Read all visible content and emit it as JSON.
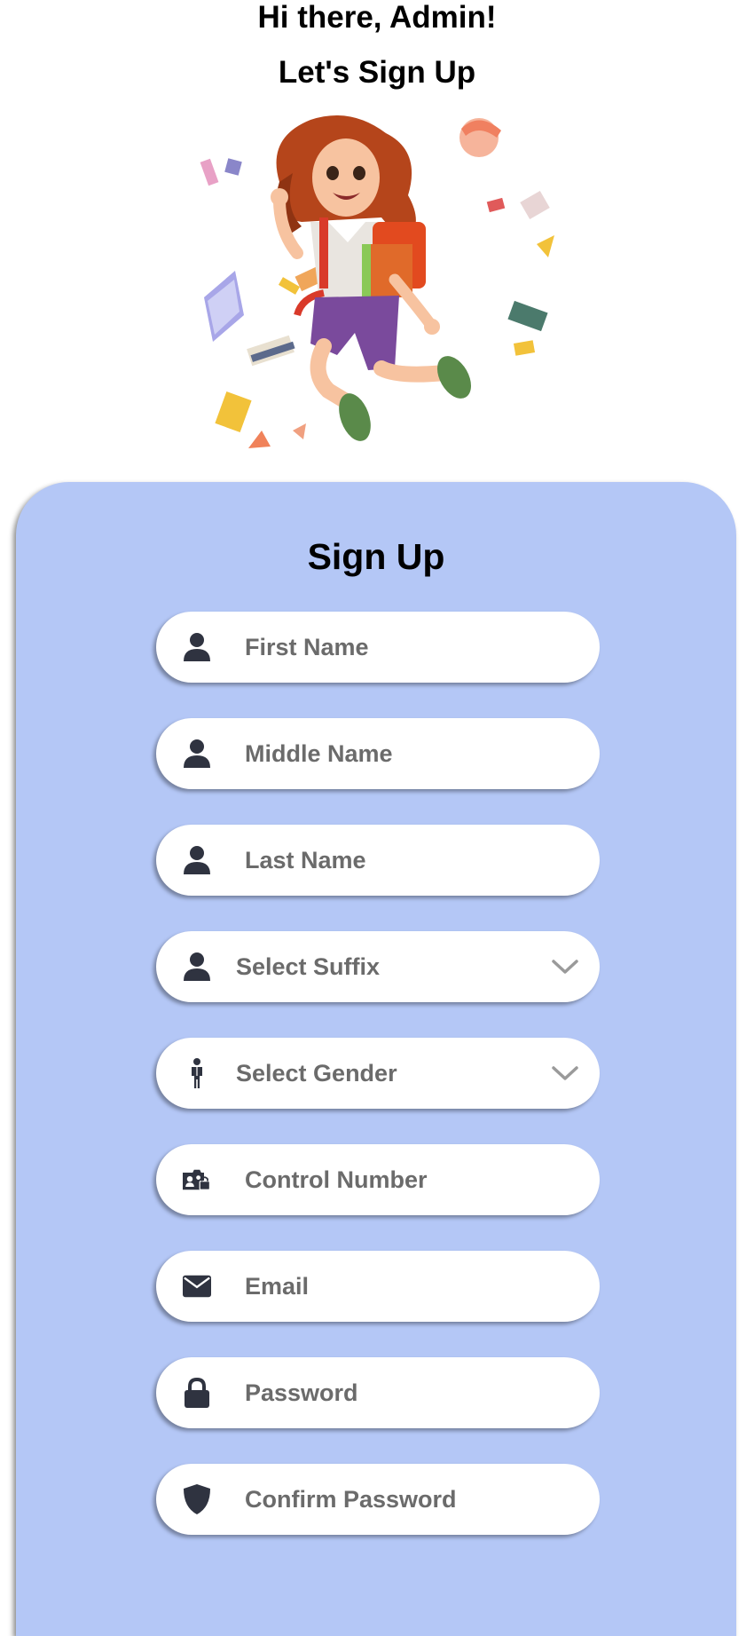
{
  "header": {
    "greeting": "Hi there, Admin!",
    "subtitle": "Let's Sign Up"
  },
  "hero": {
    "image_alt": "girl-running-with-books-illustration"
  },
  "form": {
    "title": "Sign Up",
    "fields": {
      "first_name": {
        "placeholder": "First Name",
        "icon": "user-icon"
      },
      "middle_name": {
        "placeholder": "Middle Name",
        "icon": "user-icon"
      },
      "last_name": {
        "placeholder": "Last Name",
        "icon": "user-icon"
      },
      "suffix": {
        "label": "Select Suffix",
        "icon": "user-icon"
      },
      "gender": {
        "label": "Select Gender",
        "icon": "person-standing-icon"
      },
      "control_number": {
        "placeholder": "Control Number",
        "icon": "id-card-icon"
      },
      "email": {
        "placeholder": "Email",
        "icon": "envelope-icon"
      },
      "password": {
        "placeholder": "Password",
        "icon": "lock-icon"
      },
      "confirm_password": {
        "placeholder": "Confirm Password",
        "icon": "shield-icon"
      }
    }
  },
  "colors": {
    "card_background": "#b4c7f6",
    "icon": "#2f3340",
    "placeholder": "#6b6b6b"
  }
}
